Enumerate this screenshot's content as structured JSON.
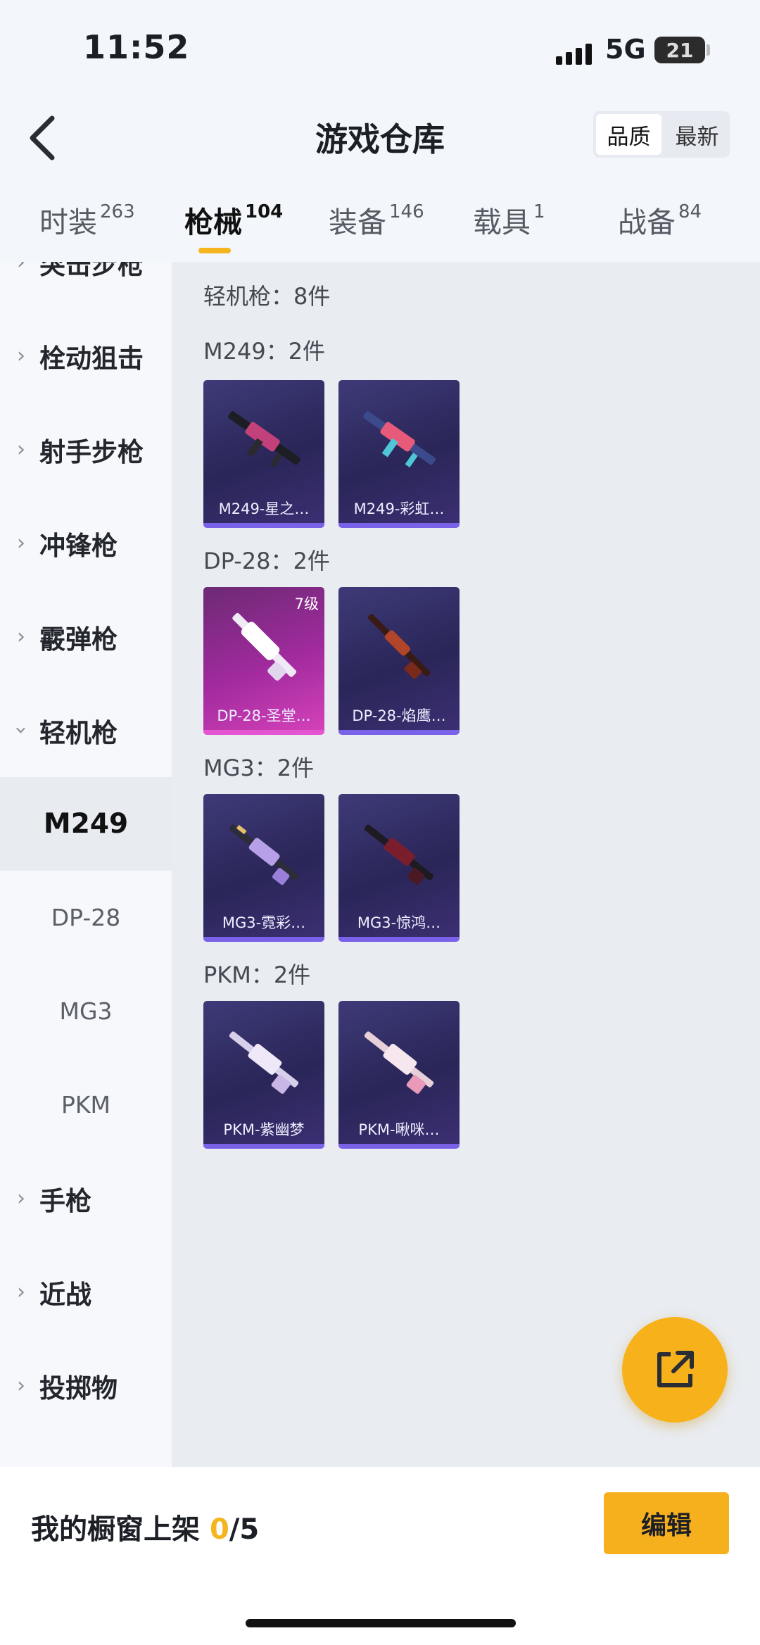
{
  "status": {
    "time": "11:52",
    "network": "5G",
    "battery": "21"
  },
  "header": {
    "title": "游戏仓库",
    "sort": [
      "品质",
      "最新"
    ]
  },
  "tabs": [
    {
      "label": "时装",
      "count": "263"
    },
    {
      "label": "枪械",
      "count": "104"
    },
    {
      "label": "装备",
      "count": "146"
    },
    {
      "label": "载具",
      "count": "1"
    },
    {
      "label": "战备",
      "count": "84"
    }
  ],
  "sidebar": {
    "items": [
      "突击步枪",
      "栓动狙击",
      "射手步枪",
      "冲锋枪",
      "霰弹枪",
      "轻机枪",
      "手枪",
      "近战",
      "投掷物"
    ],
    "sub": [
      "M249",
      "DP-28",
      "MG3",
      "PKM"
    ]
  },
  "content": {
    "summary": "轻机枪：8件",
    "groups": [
      {
        "title": "M249：2件",
        "cards": [
          {
            "label": "M249-星之…"
          },
          {
            "label": "M249-彩虹…"
          }
        ]
      },
      {
        "title": "DP-28：2件",
        "cards": [
          {
            "label": "DP-28-圣堂…",
            "level": "7级"
          },
          {
            "label": "DP-28-焰鹰…"
          }
        ]
      },
      {
        "title": "MG3：2件",
        "cards": [
          {
            "label": "MG3-霓彩…"
          },
          {
            "label": "MG3-惊鸿…"
          }
        ]
      },
      {
        "title": "PKM：2件",
        "cards": [
          {
            "label": "PKM-紫幽梦"
          },
          {
            "label": "PKM-啾咪…"
          }
        ]
      }
    ]
  },
  "bottom": {
    "label": "我的橱窗上架 ",
    "count": "0",
    "total": "/5",
    "edit": "编辑"
  },
  "colors": {
    "accent": "#f5b51e",
    "card_purple": "#2a2658",
    "card_pink": "#a12a9e"
  }
}
